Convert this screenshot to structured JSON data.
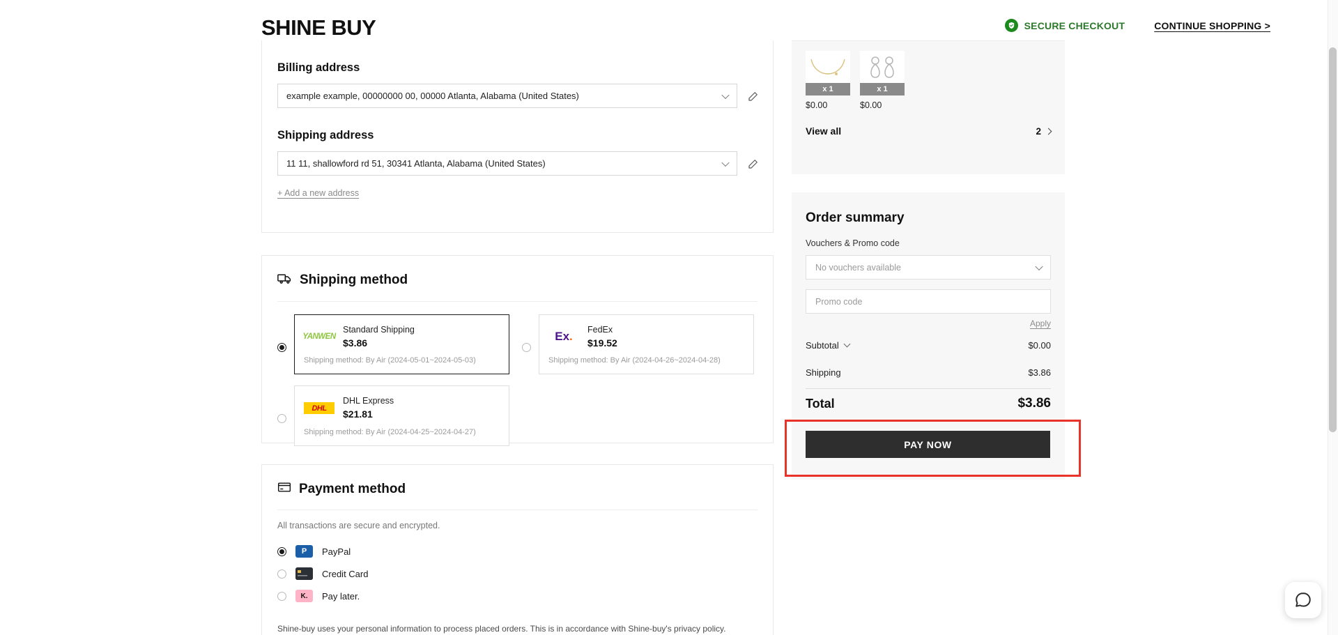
{
  "header": {
    "logo": "SHINE BUY",
    "secure_checkout": "SECURE CHECKOUT",
    "continue_shopping": "CONTINUE SHOPPING >",
    "secure_color": "#2b7a2b"
  },
  "address": {
    "billing_label": "Billing address",
    "billing_value": "example example, 00000000 00, 00000 Atlanta, Alabama (United States)",
    "shipping_label": "Shipping address",
    "shipping_value": "11 11, shallowford rd 51, 30341 Atlanta, Alabama (United States)",
    "add_new": "+ Add a new address"
  },
  "shipping": {
    "title": "Shipping method",
    "options": [
      {
        "carrier": "YANWEN",
        "name": "Standard Shipping",
        "price": "$3.86",
        "detail": "Shipping method: By Air (2024-05-01~2024-05-03)",
        "selected": true
      },
      {
        "carrier": "FedEx",
        "name": "FedEx",
        "price": "$19.52",
        "detail": "Shipping method: By Air (2024-04-26~2024-04-28)",
        "selected": false
      },
      {
        "carrier": "DHL",
        "name": "DHL Express",
        "price": "$21.81",
        "detail": "Shipping method: By Air (2024-04-25~2024-04-27)",
        "selected": false
      }
    ]
  },
  "payment": {
    "title": "Payment method",
    "note": "All transactions are secure and encrypted.",
    "options": [
      {
        "label": "PayPal",
        "icon": "paypal-icon",
        "glyph": "P",
        "selected": true
      },
      {
        "label": "Credit Card",
        "icon": "credit-card-icon",
        "glyph": "",
        "selected": false
      },
      {
        "label": "Pay later.",
        "icon": "klarna-icon",
        "glyph": "K.",
        "selected": false
      }
    ],
    "privacy": "Shine-buy uses your personal information to process placed orders. This is in accordance with Shine-buy's privacy policy."
  },
  "cart": {
    "items": [
      {
        "qty": "x 1",
        "price": "$0.00",
        "alt": "gold-necklace"
      },
      {
        "qty": "x 1",
        "price": "$0.00",
        "alt": "silver-earrings"
      }
    ],
    "view_all": "View all",
    "count": "2"
  },
  "summary": {
    "title": "Order summary",
    "vouchers_label": "Vouchers & Promo code",
    "voucher_value": "No vouchers available",
    "promo_placeholder": "Promo code",
    "promo_value": "",
    "apply": "Apply",
    "rows": [
      {
        "label": "Subtotal",
        "value": "$0.00"
      },
      {
        "label": "Shipping",
        "value": "$3.86"
      }
    ],
    "total_label": "Total",
    "total_value": "$3.86",
    "pay_now": "PAY NOW",
    "highlight_color": "#e8332a"
  }
}
